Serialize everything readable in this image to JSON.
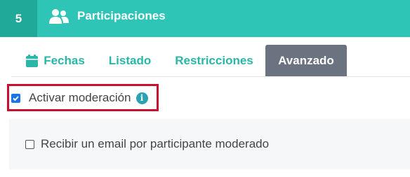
{
  "header": {
    "step_number": "5",
    "icon": "users-icon",
    "title": "Participaciones",
    "colors": {
      "header_bg": "#2ec4b6",
      "step_bg": "#20a898"
    }
  },
  "tabs": [
    {
      "label": "Fechas",
      "icon": "calendar-icon",
      "active": false
    },
    {
      "label": "Listado",
      "active": false
    },
    {
      "label": "Restricciones",
      "active": false
    },
    {
      "label": "Avanzado",
      "active": true
    }
  ],
  "moderation": {
    "label": "Activar moderación",
    "checked": true,
    "info_icon": "info-icon",
    "highlight_color": "#c8102e"
  },
  "email_option": {
    "label": "Recibir un email por participante moderado",
    "checked": false
  }
}
